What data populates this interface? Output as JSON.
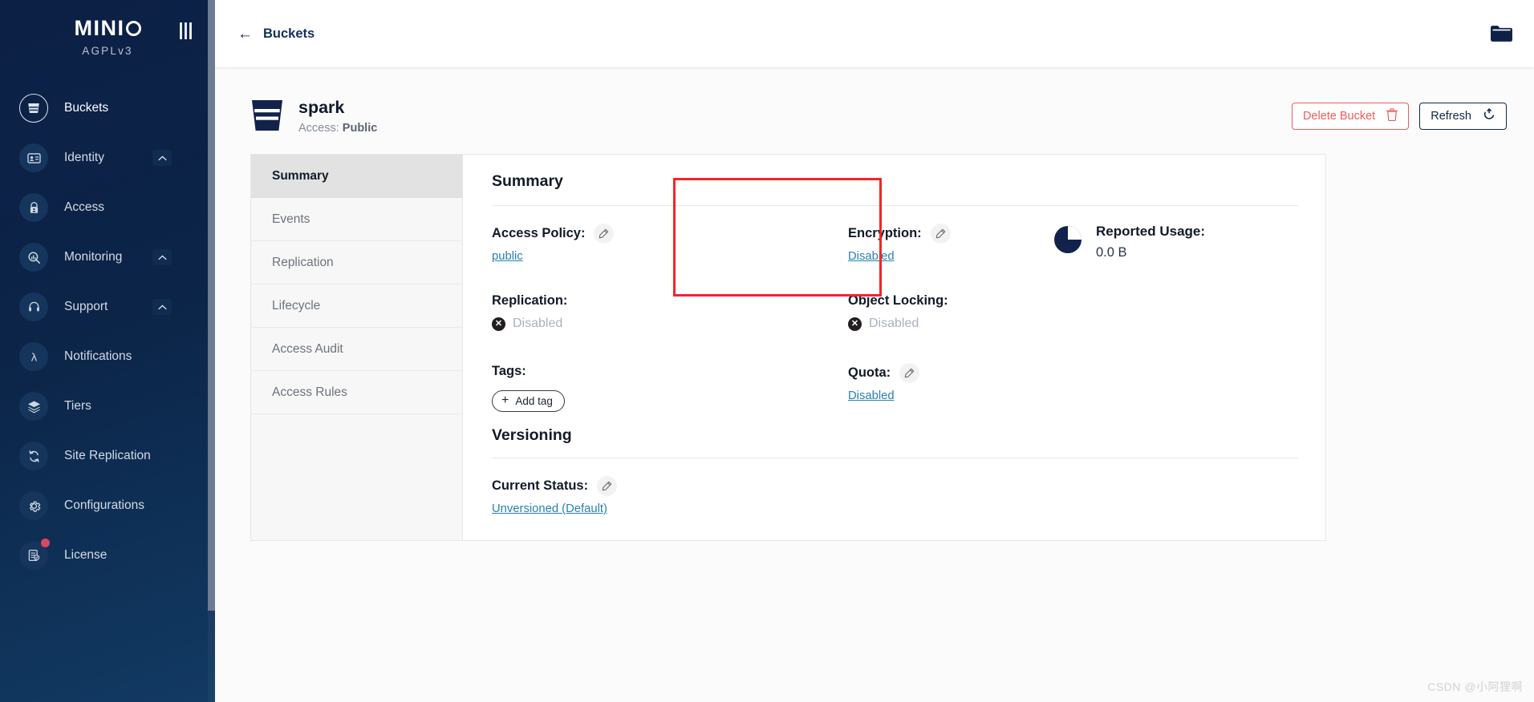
{
  "brand": {
    "logo_main": "MIN",
    "logo_i": "I",
    "license": "AGPLv3",
    "collapse_icon": "collapse-menu-icon"
  },
  "sidebar": {
    "items": [
      {
        "label": "Buckets",
        "icon": "bucket-icon",
        "active": true,
        "chevron": false,
        "badge": false
      },
      {
        "label": "Identity",
        "icon": "identity-card-icon",
        "active": false,
        "chevron": true,
        "badge": false
      },
      {
        "label": "Access",
        "icon": "lock-person-icon",
        "active": false,
        "chevron": false,
        "badge": false
      },
      {
        "label": "Monitoring",
        "icon": "magnifier-chart-icon",
        "active": false,
        "chevron": true,
        "badge": false
      },
      {
        "label": "Support",
        "icon": "headset-icon",
        "active": false,
        "chevron": true,
        "badge": false
      },
      {
        "label": "Notifications",
        "icon": "lambda-icon",
        "active": false,
        "chevron": false,
        "badge": false
      },
      {
        "label": "Tiers",
        "icon": "layers-icon",
        "active": false,
        "chevron": false,
        "badge": false
      },
      {
        "label": "Site Replication",
        "icon": "sync-circle-icon",
        "active": false,
        "chevron": false,
        "badge": false
      },
      {
        "label": "Configurations",
        "icon": "gear-icon",
        "active": false,
        "chevron": false,
        "badge": false
      },
      {
        "label": "License",
        "icon": "license-doc-icon",
        "active": false,
        "chevron": false,
        "badge": true
      }
    ]
  },
  "topbar": {
    "back_label": "Buckets",
    "back_icon": "arrow-left-icon",
    "folder_icon": "folder-icon"
  },
  "bucket": {
    "icon": "bucket-icon",
    "name": "spark",
    "access_label": "Access:",
    "access_value": "Public"
  },
  "actions": {
    "delete_label": "Delete Bucket",
    "delete_icon": "trash-icon",
    "refresh_label": "Refresh",
    "refresh_icon": "refresh-icon"
  },
  "tabs": [
    {
      "label": "Summary",
      "active": true
    },
    {
      "label": "Events",
      "active": false
    },
    {
      "label": "Replication",
      "active": false
    },
    {
      "label": "Lifecycle",
      "active": false
    },
    {
      "label": "Access Audit",
      "active": false
    },
    {
      "label": "Access Rules",
      "active": false
    }
  ],
  "summary": {
    "title": "Summary",
    "access_policy": {
      "label": "Access Policy:",
      "value": "public",
      "edit_icon": "pencil-icon"
    },
    "replication": {
      "label": "Replication:",
      "value": "Disabled",
      "status_icon": "x-circle-icon"
    },
    "encryption": {
      "label": "Encryption:",
      "value": "Disabled",
      "edit_icon": "pencil-icon"
    },
    "object_locking": {
      "label": "Object Locking:",
      "value": "Disabled",
      "status_icon": "x-circle-icon"
    },
    "quota": {
      "label": "Quota:",
      "value": "Disabled",
      "edit_icon": "pencil-icon"
    },
    "reported_usage": {
      "label": "Reported Usage:",
      "value": "0.0 B",
      "icon": "pie-chart-icon"
    },
    "tags": {
      "label": "Tags:",
      "add_label": "Add tag",
      "add_icon": "plus-icon"
    },
    "versioning": {
      "title": "Versioning",
      "status_label": "Current Status:",
      "status_value": "Unversioned (Default)",
      "edit_icon": "pencil-icon"
    }
  },
  "watermark": "CSDN @小阿狸啊",
  "colors": {
    "sidebar_bg": "#0b2447",
    "accent_navy": "#0f2748",
    "danger": "#f05a5a",
    "link": "#2781b0",
    "annotation": "#f5232d",
    "disabled_text": "#a9b2be"
  }
}
